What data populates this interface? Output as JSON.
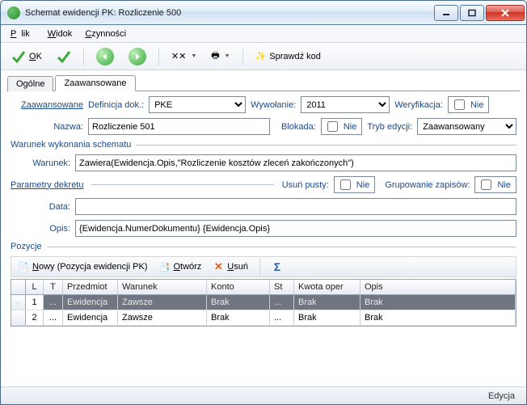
{
  "window": {
    "title": "Schemat ewidencji PK: Rozliczenie 500"
  },
  "menu": {
    "plik": "Plik",
    "widok": "Widok",
    "czynnosci": "Czynności"
  },
  "toolbar": {
    "ok": "OK",
    "sprawdz": "Sprawdź kod"
  },
  "tabs": {
    "ogolne": "Ogólne",
    "zaawansowane": "Zaawansowane"
  },
  "labels": {
    "zaawansowane": "Zaawansowane",
    "definicja": "Definicja dok.:",
    "wywolanie": "Wywołanie:",
    "weryfikacja": "Weryfikacja:",
    "nazwa": "Nazwa:",
    "blokada": "Blokada:",
    "tryb": "Tryb edycji:",
    "nie": "Nie",
    "warunek": "Warunek:",
    "data": "Data:",
    "opis": "Opis:",
    "usun_pusty": "Usuń pusty:",
    "grupowanie": "Grupowanie zapisów:"
  },
  "sections": {
    "warunek_schematu": "Warunek wykonania schematu",
    "parametry": "Parametry dekretu",
    "pozycje": "Pozycje"
  },
  "fields": {
    "definicja": "PKE",
    "wywolanie": "2011",
    "nazwa": "Rozliczenie 501",
    "tryb": "Zaawansowany",
    "warunek": "Zawiera(Ewidencja.Opis,\"Rozliczenie kosztów zleceń zakończonych\")",
    "data": "",
    "opis": "{Ewidencja.NumerDokumentu} {Ewidencja.Opis}"
  },
  "grid_toolbar": {
    "nowy": "Nowy (Pozycja ewidencji PK)",
    "otworz": "Otwórz",
    "usun": "Usuń"
  },
  "grid": {
    "headers": {
      "l": "L",
      "t": "T",
      "przedmiot": "Przedmiot",
      "warunek": "Warunek",
      "konto": "Konto",
      "st": "St",
      "kwota": "Kwota oper",
      "opis": "Opis"
    },
    "rows": [
      {
        "l": "1",
        "t": "...",
        "przedmiot": "Ewidencja",
        "warunek": "Zawsze",
        "konto": "Brak",
        "st": "...",
        "kwota": "Brak",
        "opis": "Brak"
      },
      {
        "l": "2",
        "t": "...",
        "przedmiot": "Ewidencja",
        "warunek": "Zawsze",
        "konto": "Brak",
        "st": "...",
        "kwota": "Brak",
        "opis": "Brak"
      }
    ]
  },
  "status": {
    "mode": "Edycja"
  }
}
